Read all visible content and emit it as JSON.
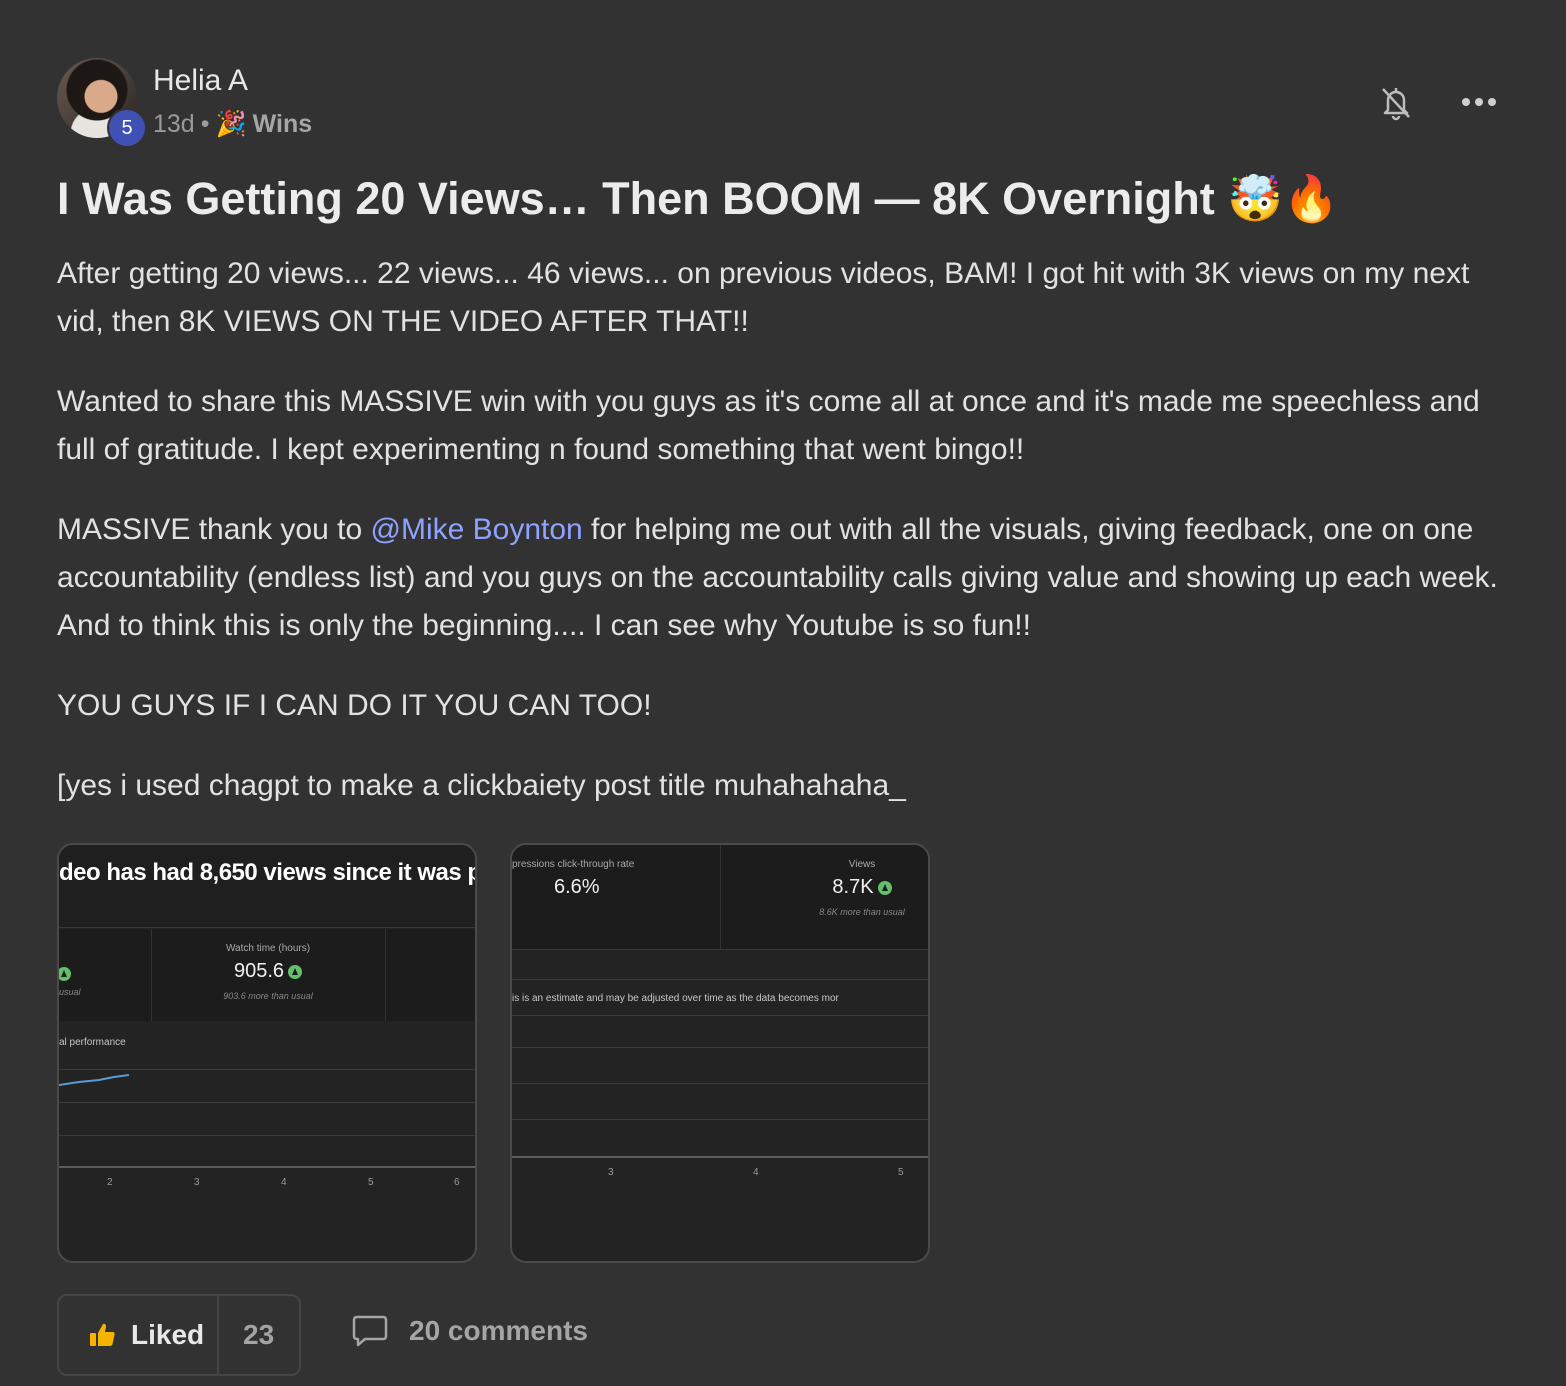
{
  "post": {
    "author": "Helia A",
    "level": "5",
    "time_ago": "13d",
    "separator": "•",
    "category_emoji": "🎉",
    "category": "Wins",
    "title": "I Was Getting 20 Views… Then BOOM — 8K Overnight 🤯🔥",
    "paragraphs": {
      "p1": "After getting 20 views... 22 views... 46 views... on previous videos, BAM! I got hit with 3K views on my next vid, then 8K VIEWS ON THE VIDEO AFTER THAT!!",
      "p2": "Wanted to share this MASSIVE win with you guys as it's come all at once and it's made me speechless and full of gratitude. I kept experimenting n found something that went bingo!!",
      "p3_before": "MASSIVE thank you to ",
      "p3_mention": "@Mike Boynton",
      "p3_after": " for helping me out with all the visuals, giving feedback, one on one accountability (endless list) and you guys on the accountability calls giving value and showing up each week. And to think this is only the beginning.... I can see why Youtube is so fun!!",
      "p4": "YOU GUYS IF I CAN DO IT YOU CAN TOO!",
      "p5": "[yes i used chagpt to make a clickbaiety post title muhahahaha_"
    }
  },
  "images": {
    "shot1": {
      "headline": "deo has had 8,650 views since it was pu",
      "metric_label": "Watch time (hours)",
      "metric_value": "905.6",
      "metric_sub": "903.6 more than usual",
      "left_sub": "usual",
      "section": "al performance",
      "ticks": [
        "2",
        "3",
        "4",
        "5",
        "6"
      ]
    },
    "shot2": {
      "ctr_label": "pressions click-through rate",
      "ctr_value": "6.6%",
      "views_label": "Views",
      "views_value": "8.7K",
      "views_sub": "8.6K more than usual",
      "note": "is is an estimate and may be adjusted over time as the data becomes mor",
      "ticks": [
        "3",
        "4",
        "5"
      ]
    }
  },
  "actions": {
    "like_label": "Liked",
    "like_count": "23",
    "comments_label": "20 comments"
  },
  "colors": {
    "background": "#323232",
    "mention": "#8ea2ff",
    "level_badge": "#3f51b5"
  }
}
